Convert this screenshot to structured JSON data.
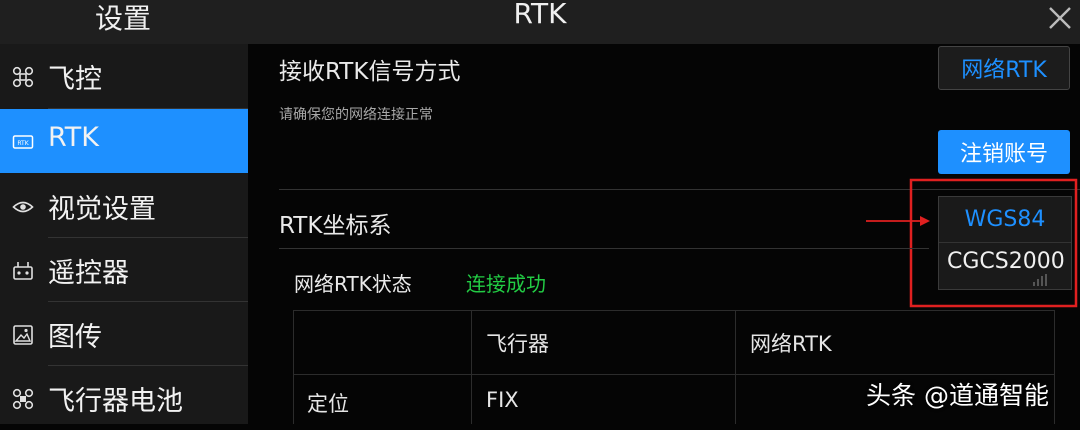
{
  "header": {
    "settings_title": "设置",
    "page_title": "RTK"
  },
  "sidebar": {
    "items": [
      {
        "label": "飞控",
        "icon": "drone-icon",
        "active": false
      },
      {
        "label": "RTK",
        "icon": "rtk-icon",
        "active": true
      },
      {
        "label": "视觉设置",
        "icon": "eye-icon",
        "active": false
      },
      {
        "label": "遥控器",
        "icon": "remote-controller-icon",
        "active": false
      },
      {
        "label": "图传",
        "icon": "image-transmission-icon",
        "active": false
      },
      {
        "label": "飞行器电池",
        "icon": "battery-icon",
        "active": false
      }
    ]
  },
  "main": {
    "receive_method_label": "接收RTK信号方式",
    "receive_method_value": "网络RTK",
    "network_hint": "请确保您的网络连接正常",
    "logout_button": "注销账号",
    "coord_system_label": "RTK坐标系",
    "coord_dropdown": {
      "options": [
        "WGS84",
        "CGCS2000"
      ],
      "selected": "WGS84"
    },
    "network_status_label": "网络RTK状态",
    "network_status_value": "连接成功",
    "table": {
      "headers": [
        "",
        "飞行器",
        "网络RTK"
      ],
      "rows": [
        [
          "定位",
          "FIX",
          ""
        ]
      ]
    }
  },
  "watermark": "头条 @道通智能",
  "colors": {
    "accent": "#1e90ff",
    "success": "#22cc44",
    "annotation": "#e02020",
    "topbar": "#1f1f1f",
    "sidebar": "#191919",
    "background": "#050505"
  }
}
